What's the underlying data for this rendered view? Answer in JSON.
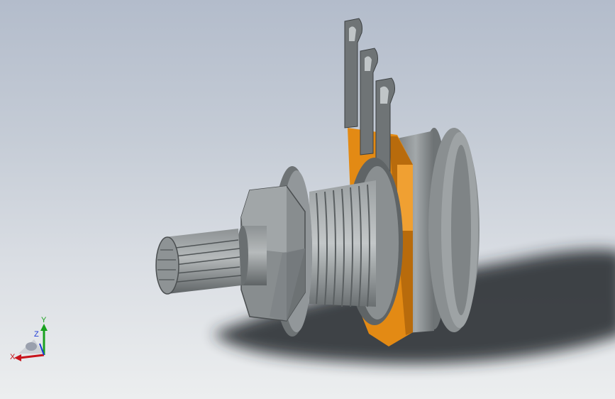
{
  "triad": {
    "x_label": "X",
    "y_label": "Y",
    "z_label": "Z",
    "x_color": "#c8141c",
    "y_color": "#19a11f",
    "z_color": "#1f3bd6"
  },
  "colors": {
    "background_top": "#b3bccb",
    "background_bottom": "#eceeef",
    "body_gray": "#8c9193",
    "terminal_gray": "#6f7476",
    "insulator_orange": "#e38a14",
    "shadow": "#24282c"
  }
}
